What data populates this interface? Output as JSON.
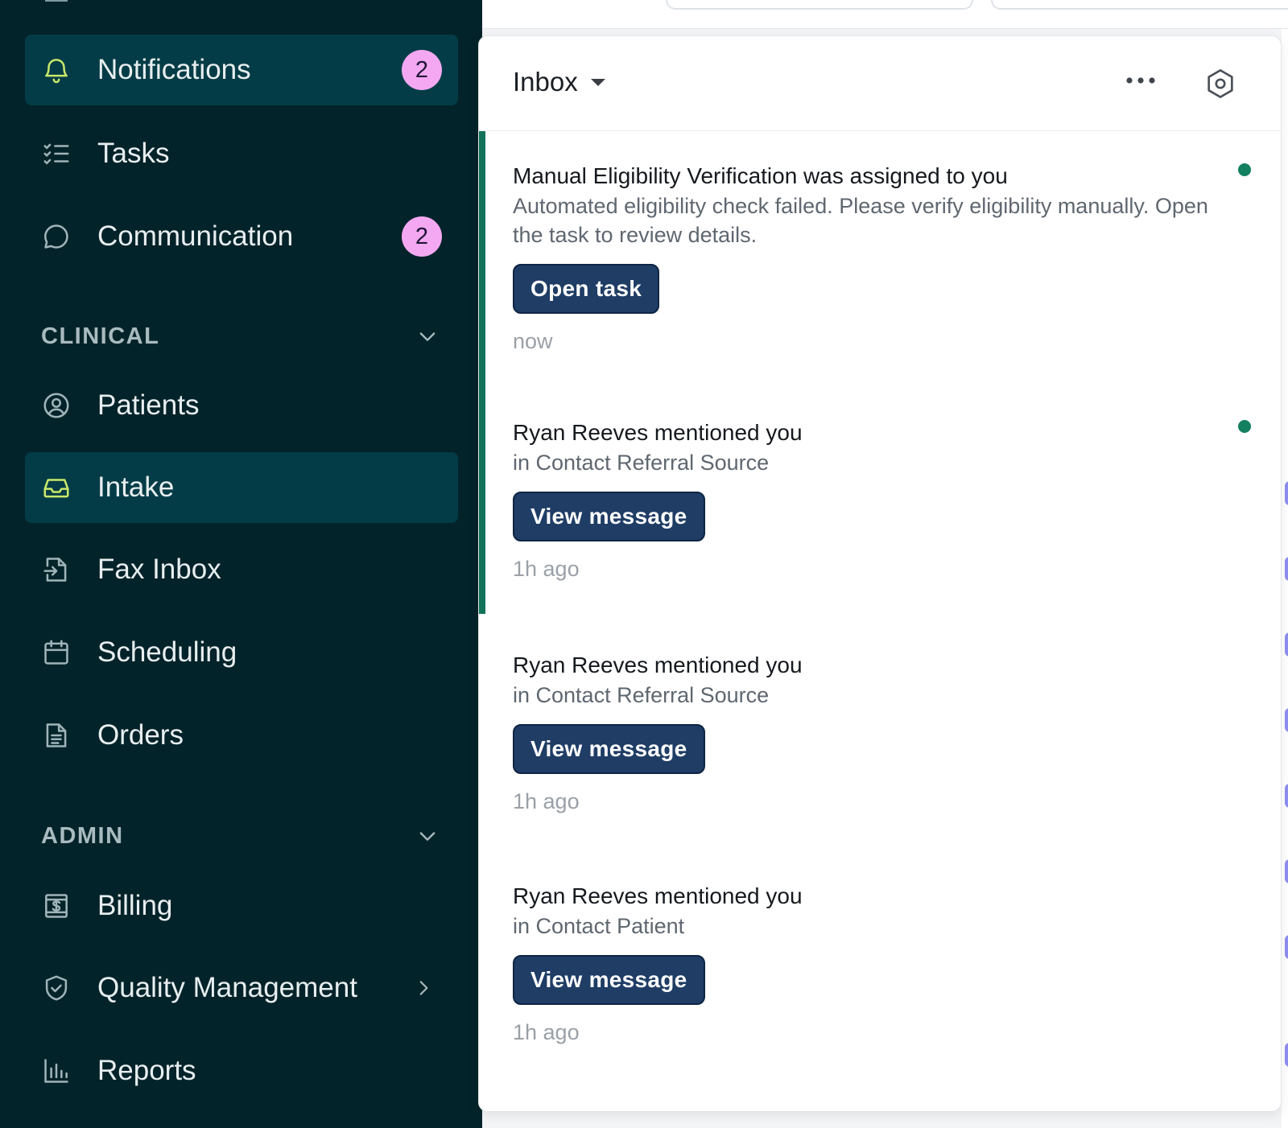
{
  "sidebar": {
    "items": [
      {
        "label": "Notifications",
        "icon": "bell-icon",
        "badge": "2"
      },
      {
        "label": "Tasks",
        "icon": "checklist-icon"
      },
      {
        "label": "Communication",
        "icon": "chat-bubble-icon",
        "badge": "2"
      },
      {
        "label": "Patients",
        "icon": "user-circle-icon"
      },
      {
        "label": "Intake",
        "icon": "inbox-tray-icon"
      },
      {
        "label": "Fax Inbox",
        "icon": "file-import-icon"
      },
      {
        "label": "Scheduling",
        "icon": "calendar-icon"
      },
      {
        "label": "Orders",
        "icon": "document-icon"
      },
      {
        "label": "Billing",
        "icon": "dollar-receipt-icon"
      },
      {
        "label": "Quality Management",
        "icon": "shield-check-icon"
      },
      {
        "label": "Reports",
        "icon": "bar-chart-icon"
      }
    ],
    "sections": {
      "clinical": "CLINICAL",
      "admin": "ADMIN"
    }
  },
  "panel": {
    "title": "Inbox",
    "notifications": [
      {
        "title": "Manual Eligibility Verification was assigned to you",
        "body": "Automated eligibility check failed. Please verify eligibility manually. Open the task to review details.",
        "button": "Open task",
        "time": "now",
        "unread": true
      },
      {
        "title": "Ryan Reeves mentioned you",
        "body": "in Contact Referral Source",
        "button": "View message",
        "time": "1h ago",
        "unread": true
      },
      {
        "title": "Ryan Reeves mentioned you",
        "body": "in Contact Referral Source",
        "button": "View message",
        "time": "1h ago",
        "unread": false
      },
      {
        "title": "Ryan Reeves mentioned you",
        "body": "in Contact Patient",
        "button": "View message",
        "time": "1h ago",
        "unread": false
      }
    ]
  },
  "colors": {
    "sidebar_bg": "#022329",
    "sidebar_active": "#033c46",
    "badge_bg": "#f5a8f2",
    "button_bg": "#1f3d65",
    "unread_accent": "#12735a"
  }
}
